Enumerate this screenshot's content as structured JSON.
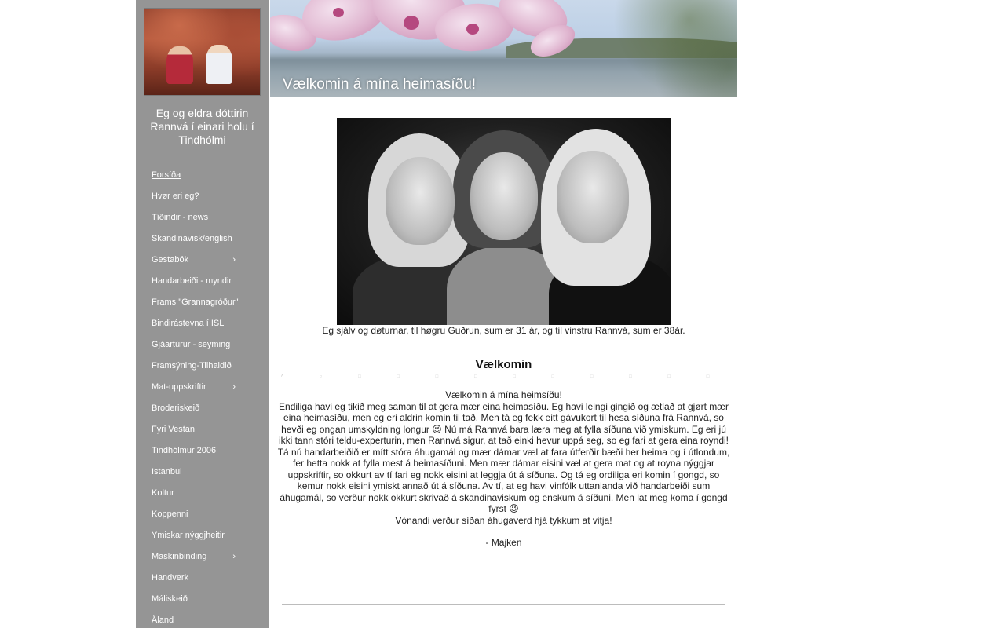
{
  "sidebar": {
    "profile_caption": "Eg og eldra dóttirin Rannvá í einari holu í Tindhólmi",
    "items": [
      {
        "label": "Forsíða",
        "active": true,
        "submenu": false
      },
      {
        "label": "Hvør eri eg?",
        "submenu": false
      },
      {
        "label": "Tíðindir - news",
        "submenu": false
      },
      {
        "label": "Skandinavisk/english",
        "submenu": false
      },
      {
        "label": "Gestabók",
        "submenu": true
      },
      {
        "label": "Handarbeiði - myndir",
        "submenu": false
      },
      {
        "label": "Frams \"Grannagróður\"",
        "submenu": false
      },
      {
        "label": "Bindirástevna í ISL",
        "submenu": false
      },
      {
        "label": "Gjáartúrur - seyming",
        "submenu": false
      },
      {
        "label": "Framsýning-Tilhaldið",
        "submenu": false
      },
      {
        "label": "Mat-uppskriftir",
        "submenu": true
      },
      {
        "label": "Broderiskeið",
        "submenu": false
      },
      {
        "label": "Fyri Vestan",
        "submenu": false
      },
      {
        "label": "Tindhólmur 2006",
        "submenu": false
      },
      {
        "label": "Istanbul",
        "submenu": false
      },
      {
        "label": "Koltur",
        "submenu": false
      },
      {
        "label": "Koppenni",
        "submenu": false
      },
      {
        "label": "Ymiskar nýggjheitir",
        "submenu": false
      },
      {
        "label": "Maskinbinding",
        "submenu": true
      },
      {
        "label": "Handverk",
        "submenu": false
      },
      {
        "label": "Máliskeið",
        "submenu": false
      },
      {
        "label": "Åland",
        "submenu": false
      }
    ],
    "chevron_icon": "chevron-right-icon",
    "chevron_glyph": "›"
  },
  "header": {
    "title": "Vælkomin á mína heimasíðu!"
  },
  "main": {
    "photo_caption": "Eg sjálv og døturnar, til høgru Guðrun, sum er 31 ár, og til vinstru Rannvá, sum er 38ár.",
    "heading": "Vælkomin",
    "dots": "˄ ○ □ □ □ □ □ □ □ □ □ □ □ □ □ ○ ˄",
    "intro_line": "Vælkomin á mína heimsíðu!",
    "paragraph": "Endiliga havi eg tikið meg saman til at gera mær eina heimasíðu. Eg havi leingi gingið og ætlað at gjørt mær eina heimasíðu, men eg eri aldrin komin til tað. Men tá eg  fekk eitt gávukort til hesa síðuna frá Rannvá, so hevði eg ongan umskyldning longur 😉 Nú má Rannvá bara læra meg at fylla síðuna við ymiskum. Eg eri jú ikki tann stóri teldu-experturin, men Rannvá sigur, at tað einki hevur uppá seg, so eg fari at gera eina royndi! Tá nú handarbeiðið er mítt stóra áhugamál og mær dámar væl at fara útferðir bæði her heima og í útlondum, fer hetta nokk at fylla mest á heimasíðuni. Men mær dámar eisini væl at gera mat og at royna nýggjar uppskriftir, so okkurt av tí fari eg nokk eisini at leggja út á síðuna. Og tá eg ordiliga eri komin í gongd, so kemur nokk eisini ymiskt annað út á síðuna. Av tí, at eg havi vinfólk uttanlanda við handarbeiði sum áhugamál, so verður nokk okkurt skrivað á skandinaviskum og enskum á síðuni. Men lat meg koma í gongd fyrst 😉",
    "closing_line": "Vónandi verður síðan áhugaverd hjá tykkum at vitja!",
    "signature": "- Majken"
  },
  "colors": {
    "sidebar_bg": "#959595",
    "nav_text": "#ffffff",
    "body_text": "#222222"
  }
}
